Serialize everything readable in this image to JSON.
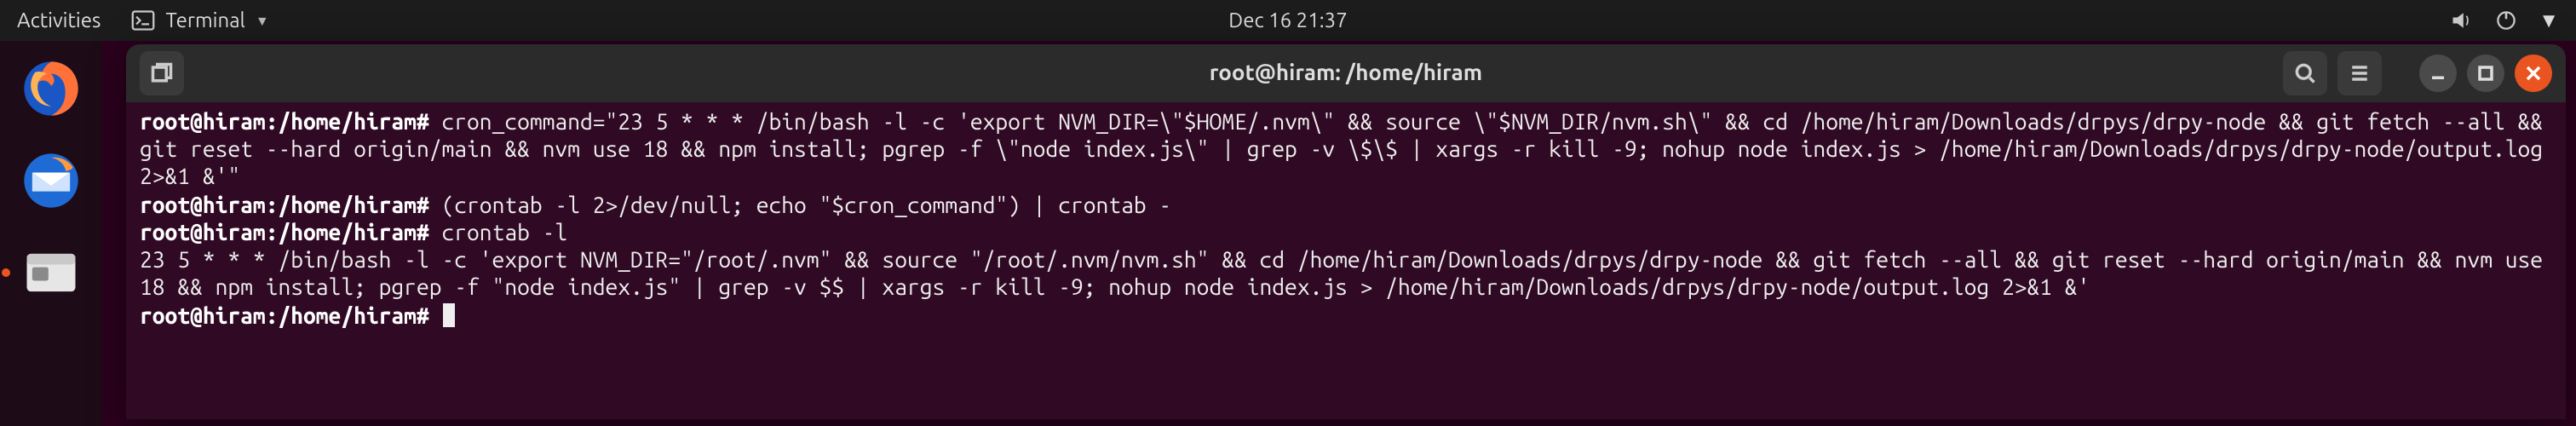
{
  "topbar": {
    "activities": "Activities",
    "app_label": "Terminal",
    "datetime": "Dec 16  21:37"
  },
  "dock": {
    "items": [
      {
        "name": "firefox"
      },
      {
        "name": "thunderbird"
      },
      {
        "name": "files"
      }
    ]
  },
  "window": {
    "title": "root@hiram: /home/hiram"
  },
  "terminal": {
    "prompt": "root@hiram:/home/hiram#",
    "lines": [
      {
        "prompt": true,
        "text": "cron_command=\"23 5 * * * /bin/bash -l -c 'export NVM_DIR=\\\"$HOME/.nvm\\\" && source \\\"$NVM_DIR/nvm.sh\\\" && cd /home/hiram/Downloads/drpys/drpy-node && git fetch --all && git reset --hard origin/main && nvm use 18 && npm install; pgrep -f \\\"node index.js\\\" | grep -v \\$\\$ | xargs -r kill -9; nohup node index.js > /home/hiram/Downloads/drpys/drpy-node/output.log 2>&1 &'\""
      },
      {
        "prompt": true,
        "text": "(crontab -l 2>/dev/null; echo \"$cron_command\") | crontab -"
      },
      {
        "prompt": true,
        "text": "crontab -l"
      },
      {
        "prompt": false,
        "text": "23 5 * * * /bin/bash -l -c 'export NVM_DIR=\"/root/.nvm\" && source \"/root/.nvm/nvm.sh\" && cd /home/hiram/Downloads/drpys/drpy-node && git fetch --all && git reset --hard origin/main && nvm use 18 && npm install; pgrep -f \"node index.js\" | grep -v $$ | xargs -r kill -9; nohup node index.js > /home/hiram/Downloads/drpys/drpy-node/output.log 2>&1 &'"
      },
      {
        "prompt": true,
        "text": "",
        "cursor": true
      }
    ]
  }
}
